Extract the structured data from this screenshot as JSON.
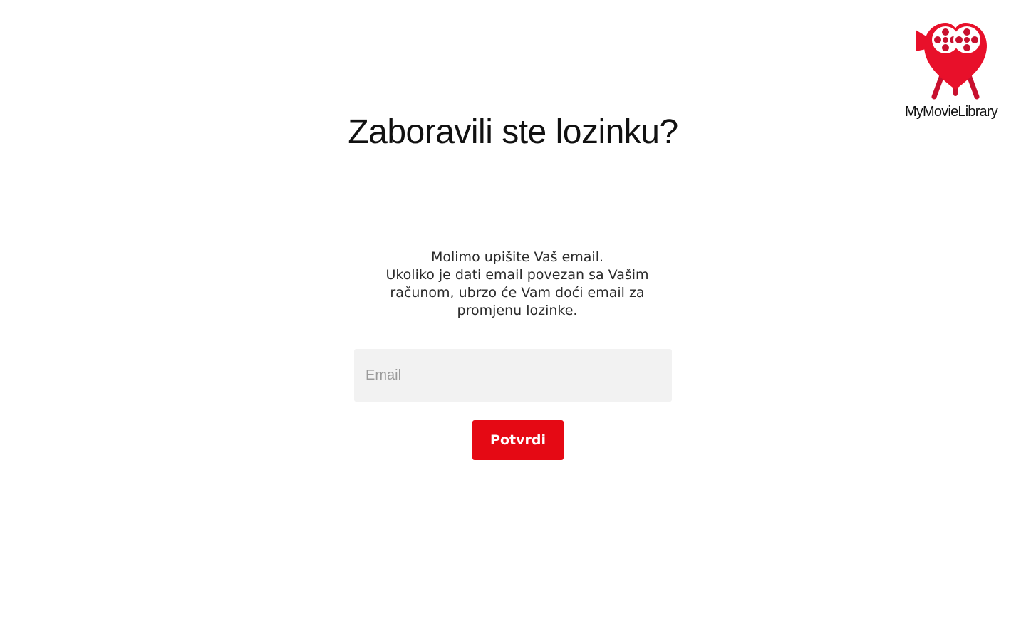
{
  "brand": {
    "name": "MyMovieLibrary",
    "logo_icon": "heart-film-reel-camera-icon",
    "accent_color": "#e50914"
  },
  "page": {
    "title": "Zaboravili ste lozinku?",
    "instructions": [
      "Molimo upišite Vaš email.",
      "Ukoliko je dati email povezan sa Vašim računom, ubrzo će Vam doći email za promjenu lozinke."
    ]
  },
  "form": {
    "email_placeholder": "Email",
    "email_value": "",
    "submit_label": "Potvrdi"
  }
}
